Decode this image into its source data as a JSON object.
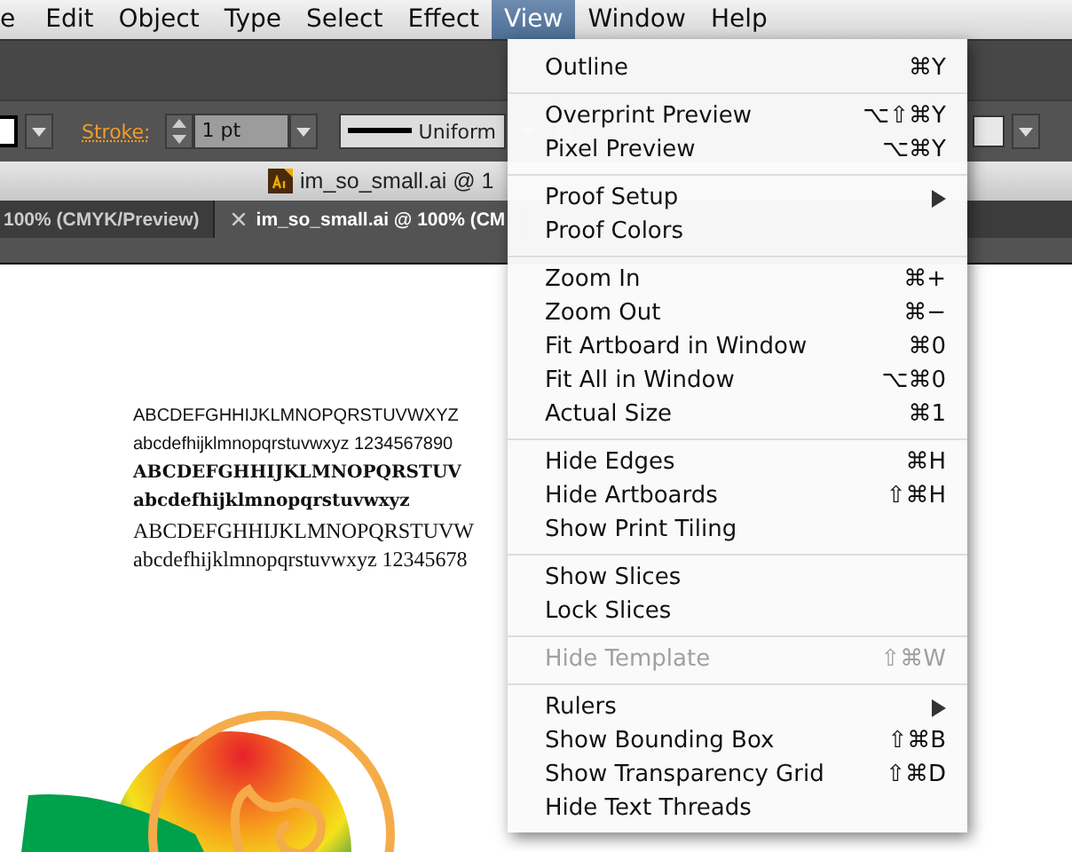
{
  "menu_bar": [
    {
      "label": "e",
      "selected": false
    },
    {
      "label": "Edit",
      "selected": false
    },
    {
      "label": "Object",
      "selected": false
    },
    {
      "label": "Type",
      "selected": false
    },
    {
      "label": "Select",
      "selected": false
    },
    {
      "label": "Effect",
      "selected": false
    },
    {
      "label": "View",
      "selected": true
    },
    {
      "label": "Window",
      "selected": false
    },
    {
      "label": "Help",
      "selected": false
    }
  ],
  "control_bar": {
    "stroke_label": "Stroke:",
    "stroke_weight": "1 pt",
    "stroke_profile": "Uniform"
  },
  "document_title": "im_so_small.ai @ 1",
  "tabs": [
    {
      "label": "100% (CMYK/Preview)",
      "selected": false
    },
    {
      "label": "im_so_small.ai @ 100% (CM",
      "selected": true
    }
  ],
  "canvas_text": [
    {
      "kind": "sans",
      "text": "ABCDEFGHHIJKLMNOPQRSTUVWXYZ"
    },
    {
      "kind": "sans",
      "text": "abcdefhijklmnopqrstuvwxyz 1234567890"
    },
    {
      "kind": "slab",
      "text": "ABCDEFGHHIJKLMNOPQRSTUV"
    },
    {
      "kind": "slab",
      "text": "abcdefhijklmnopqrstuvwxyz"
    },
    {
      "kind": "serif",
      "text": "ABCDEFGHHIJKLMNOPQRSTUVW"
    },
    {
      "kind": "serif",
      "text": "abcdefhijklmnopqrstuvwxyz 12345678"
    }
  ],
  "view_menu": [
    [
      {
        "label": "Outline",
        "shortcut": "⌘Y",
        "disabled": false,
        "submenu": false
      }
    ],
    [
      {
        "label": "Overprint Preview",
        "shortcut": "⌥⇧⌘Y",
        "disabled": false,
        "submenu": false
      },
      {
        "label": "Pixel Preview",
        "shortcut": "⌥⌘Y",
        "disabled": false,
        "submenu": false
      }
    ],
    [
      {
        "label": "Proof Setup",
        "disabled": false,
        "submenu": true
      },
      {
        "label": "Proof Colors",
        "disabled": false,
        "submenu": false
      }
    ],
    [
      {
        "label": "Zoom In",
        "shortcut": "⌘+",
        "disabled": false,
        "submenu": false
      },
      {
        "label": "Zoom Out",
        "shortcut": "⌘−",
        "disabled": false,
        "submenu": false
      },
      {
        "label": "Fit Artboard in Window",
        "shortcut": "⌘0",
        "disabled": false,
        "submenu": false
      },
      {
        "label": "Fit All in Window",
        "shortcut": "⌥⌘0",
        "disabled": false,
        "submenu": false
      },
      {
        "label": "Actual Size",
        "shortcut": "⌘1",
        "disabled": false,
        "submenu": false
      }
    ],
    [
      {
        "label": "Hide Edges",
        "shortcut": "⌘H",
        "disabled": false,
        "submenu": false
      },
      {
        "label": "Hide Artboards",
        "shortcut": "⇧⌘H",
        "disabled": false,
        "submenu": false
      },
      {
        "label": "Show Print Tiling",
        "disabled": false,
        "submenu": false
      }
    ],
    [
      {
        "label": "Show Slices",
        "disabled": false,
        "submenu": false
      },
      {
        "label": "Lock Slices",
        "disabled": false,
        "submenu": false
      }
    ],
    [
      {
        "label": "Hide Template",
        "shortcut": "⇧⌘W",
        "disabled": true,
        "submenu": false
      }
    ],
    [
      {
        "label": "Rulers",
        "disabled": false,
        "submenu": true
      },
      {
        "label": "Show Bounding Box",
        "shortcut": "⇧⌘B",
        "disabled": false,
        "submenu": false
      },
      {
        "label": "Show Transparency Grid",
        "shortcut": "⇧⌘D",
        "disabled": false,
        "submenu": false
      },
      {
        "label": "Hide Text Threads",
        "disabled": false,
        "submenu": false
      }
    ]
  ]
}
